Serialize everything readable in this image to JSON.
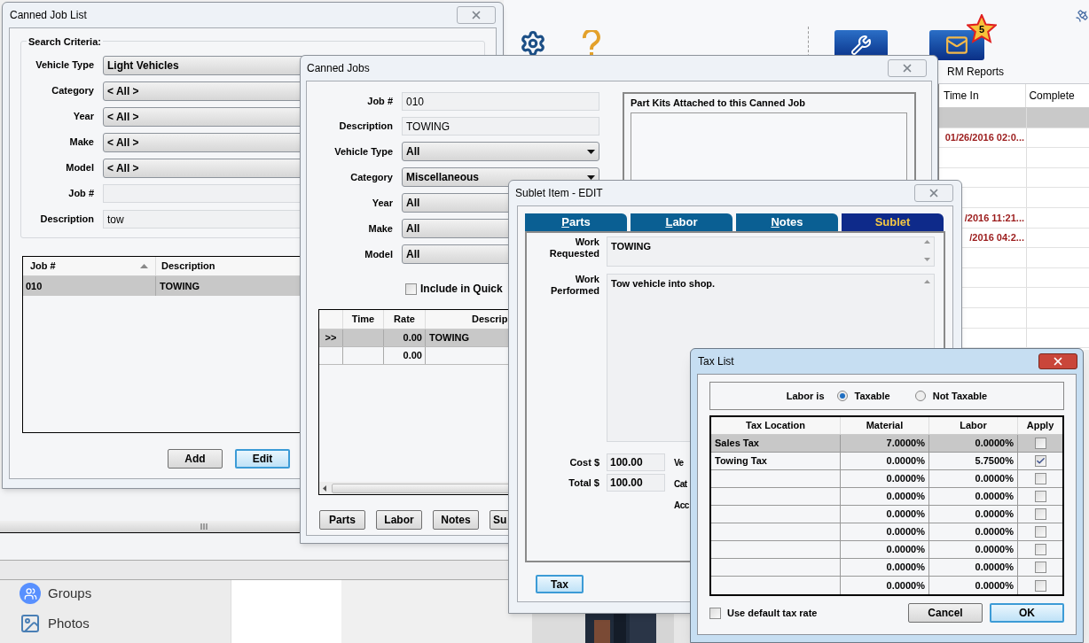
{
  "toolbar": {
    "reports_label": "RM Reports",
    "badge": "5"
  },
  "background_grid": {
    "columns": [
      "Time In",
      "Complete"
    ],
    "rows": [
      {
        "selected": true
      },
      {
        "time_in": "01/26/2016 02:0...",
        "selected": false
      },
      {
        "selected": false
      },
      {
        "selected": false
      },
      {
        "selected": false
      },
      {
        "time_in": "/2016 11:21...",
        "selected": false
      },
      {
        "time_in": "/2016 04:2...",
        "selected": false
      },
      {
        "selected": false
      },
      {
        "selected": false
      },
      {
        "selected": false
      },
      {
        "selected": false
      },
      {
        "selected": false
      }
    ]
  },
  "side_nav": [
    {
      "label": "Groups"
    },
    {
      "label": "Photos"
    }
  ],
  "canned_job_list": {
    "title": "Canned Job List",
    "search_criteria": {
      "title": "Search Criteria:",
      "fields": [
        {
          "label": "Vehicle Type",
          "value": "Light Vehicles",
          "kind": "dropdown"
        },
        {
          "label": "Category",
          "value": "< All >",
          "kind": "dropdown"
        },
        {
          "label": "Year",
          "value": "< All >",
          "kind": "dropdown"
        },
        {
          "label": "Make",
          "value": "< All >",
          "kind": "dropdown"
        },
        {
          "label": "Model",
          "value": "< All >",
          "kind": "dropdown"
        },
        {
          "label": "Job #",
          "kind": "text"
        },
        {
          "label": "Description",
          "value": "tow",
          "kind": "text"
        }
      ]
    },
    "table": {
      "columns": [
        "Job #",
        "Description"
      ],
      "rows": [
        {
          "job": "010",
          "description": "TOWING",
          "selected": true
        }
      ]
    },
    "buttons": [
      {
        "label": "Add",
        "focused": false
      },
      {
        "label": "Edit",
        "focused": true
      }
    ]
  },
  "canned_jobs": {
    "title": "Canned Jobs",
    "fields": [
      {
        "label": "Job #",
        "value": "010",
        "kind": "text"
      },
      {
        "label": "Description",
        "value": "TOWING",
        "kind": "text"
      },
      {
        "label": "Vehicle Type",
        "value": "All",
        "kind": "dropdown"
      },
      {
        "label": "Category",
        "value": "Miscellaneous",
        "kind": "dropdown"
      },
      {
        "label": "Year",
        "value": "All",
        "kind": "dropdown"
      },
      {
        "label": "Make",
        "value": "All",
        "kind": "dropdown"
      },
      {
        "label": "Model",
        "value": "All",
        "kind": "dropdown"
      }
    ],
    "quick_checkbox": {
      "label": "Include in Quick",
      "checked": false
    },
    "part_kits": {
      "title": "Part Kits Attached to this Canned Job"
    },
    "table": {
      "columns": [
        "Time",
        "Rate",
        "Descrip"
      ],
      "rows": [
        {
          "marker": ">>",
          "rate": "0.00",
          "description": "TOWING",
          "selected": true
        },
        {
          "rate": "0.00",
          "selected": false
        }
      ]
    },
    "buttons": [
      "Parts",
      "Labor",
      "Notes",
      "Su"
    ]
  },
  "sublet_item": {
    "title": "Sublet Item - EDIT",
    "tabs": [
      {
        "label": "Parts",
        "selected": false
      },
      {
        "label": "Labor",
        "selected": false
      },
      {
        "label": "Notes",
        "selected": false
      },
      {
        "label": "Sublet",
        "selected": true
      }
    ],
    "work_requested": {
      "label": "Work Requested",
      "value": "TOWING"
    },
    "work_performed": {
      "label": "Work Performed",
      "value": "Tow vehicle into shop."
    },
    "cost": {
      "label": "Cost $",
      "value": "100.00"
    },
    "total": {
      "label": "Total $",
      "value": "100.00"
    },
    "cut_labels": [
      "Ve",
      "Cat",
      "Acc"
    ],
    "tax_button": "Tax"
  },
  "tax_list": {
    "title": "Tax List",
    "labor_is": {
      "label": "Labor is",
      "options": [
        {
          "label": "Taxable",
          "selected": true
        },
        {
          "label": "Not Taxable",
          "selected": false
        }
      ]
    },
    "table": {
      "columns": [
        "Tax Location",
        "Material",
        "Labor",
        "Apply"
      ],
      "rows": [
        {
          "location": "Sales Tax",
          "material": "7.0000%",
          "labor": "0.0000%",
          "apply": false,
          "selected": true
        },
        {
          "location": "Towing Tax",
          "material": "0.0000%",
          "labor": "5.7500%",
          "apply": true,
          "selected": false
        },
        {
          "material": "0.0000%",
          "labor": "0.0000%",
          "apply": false,
          "selected": false
        },
        {
          "material": "0.0000%",
          "labor": "0.0000%",
          "apply": false,
          "selected": false
        },
        {
          "material": "0.0000%",
          "labor": "0.0000%",
          "apply": false,
          "selected": false
        },
        {
          "material": "0.0000%",
          "labor": "0.0000%",
          "apply": false,
          "selected": false
        },
        {
          "material": "0.0000%",
          "labor": "0.0000%",
          "apply": false,
          "selected": false
        },
        {
          "material": "0.0000%",
          "labor": "0.0000%",
          "apply": false,
          "selected": false
        },
        {
          "material": "0.0000%",
          "labor": "0.0000%",
          "apply": false,
          "selected": false
        }
      ]
    },
    "use_default": {
      "label": "Use default tax rate",
      "checked": false
    },
    "buttons": [
      {
        "label": "Cancel",
        "default": false
      },
      {
        "label": "OK",
        "default": true
      }
    ]
  }
}
